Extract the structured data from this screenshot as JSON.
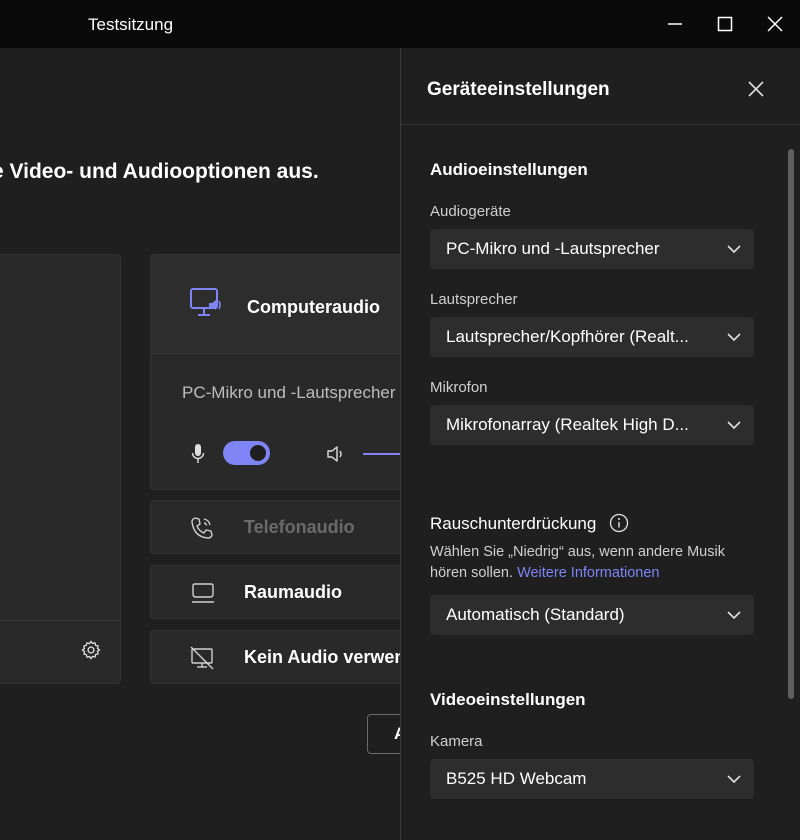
{
  "window": {
    "title": "Testsitzung"
  },
  "main": {
    "heading": "e Video- und Audiooptionen aus.",
    "audio_options": {
      "computer": {
        "label": "Computeraudio",
        "device": "PC-Mikro und -Lautsprecher"
      },
      "phone": {
        "label": "Telefonaudio"
      },
      "room": {
        "label": "Raumaudio"
      },
      "none": {
        "label": "Kein Audio verwenden"
      }
    },
    "partial_button": {
      "label": "A"
    }
  },
  "panel": {
    "title": "Geräteeinstellungen",
    "audio_section": "Audioeinstellungen",
    "audio_devices": {
      "label": "Audiogeräte",
      "value": "PC-Mikro und -Lautsprecher"
    },
    "speaker": {
      "label": "Lautsprecher",
      "value": "Lautsprecher/Kopfhörer (Realt..."
    },
    "microphone": {
      "label": "Mikrofon",
      "value": "Mikrofonarray (Realtek High D..."
    },
    "noise": {
      "label": "Rauschunterdrückung",
      "help_text": "Wählen Sie „Niedrig“ aus, wenn andere Musik hören sollen.",
      "link": "Weitere Informationen",
      "value": "Automatisch (Standard)"
    },
    "video_section": "Videoeinstellungen",
    "camera": {
      "label": "Kamera",
      "value": "B525 HD Webcam"
    }
  },
  "colors": {
    "accent": "#7f85f5",
    "background": "#1f1f1f",
    "card": "#292929",
    "titlebar": "#0a0a0a"
  }
}
